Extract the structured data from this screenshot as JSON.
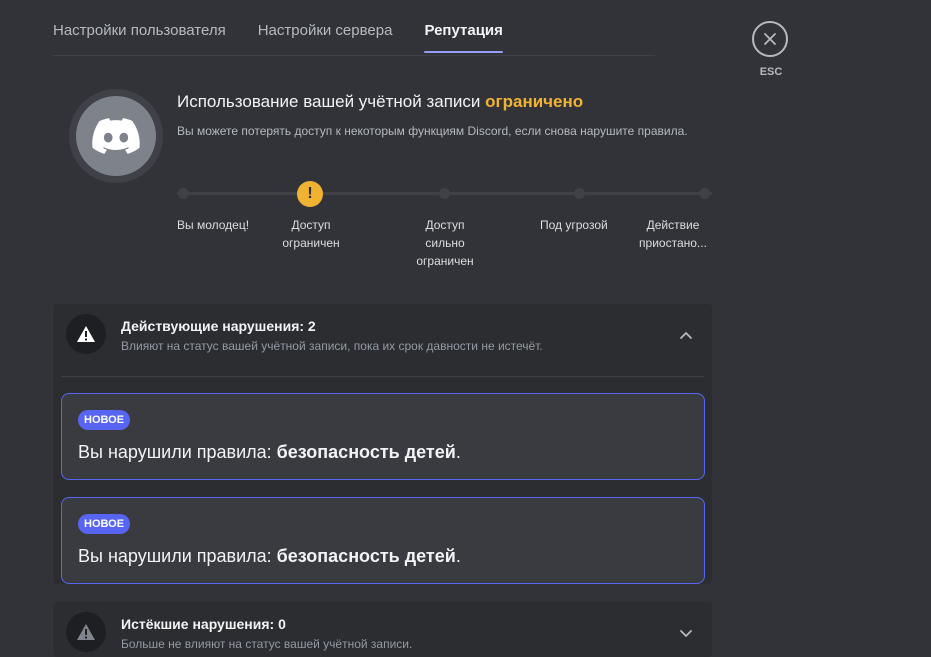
{
  "tabs": [
    {
      "label": "Настройки пользователя",
      "active": false
    },
    {
      "label": "Настройки сервера",
      "active": false
    },
    {
      "label": "Репутация",
      "active": true
    }
  ],
  "close": {
    "label": "ESC",
    "icon": "close-icon"
  },
  "avatar": {
    "icon": "discord-logo-icon"
  },
  "status": {
    "title_prefix": "Использование вашей учётной записи",
    "state": "ограничено",
    "state_color": "#f0b232",
    "description": "Вы можете потерять доступ к некоторым функциям Discord, если снова нарушите правила."
  },
  "levels": [
    {
      "label": "Вы молодец!",
      "current": false
    },
    {
      "label": "Доступ ограничен",
      "current": true,
      "marker": "!"
    },
    {
      "label": "Доступ сильно ограничен",
      "current": false
    },
    {
      "label": "Под угрозой",
      "current": false
    },
    {
      "label": "Действие приостано...",
      "current": false
    }
  ],
  "active_violations": {
    "title": "Действующие нарушения: 2",
    "subtitle": "Влияют на статус вашей учётной записи, пока их срок давности не истечёт.",
    "expanded": true,
    "items": [
      {
        "badge": "НОВОЕ",
        "prefix": "Вы нарушили правила: ",
        "rule": "безопасность детей",
        "suffix": "."
      },
      {
        "badge": "НОВОЕ",
        "prefix": "Вы нарушили правила: ",
        "rule": "безопасность детей",
        "suffix": "."
      }
    ]
  },
  "expired_violations": {
    "title": "Истёкшие нарушения: 0",
    "subtitle": "Больше не влияют на статус вашей учётной записи.",
    "expanded": false
  },
  "colors": {
    "accent": "#5865f2",
    "warning": "#f0b232",
    "background": "#313338",
    "panel": "#2b2d31"
  }
}
